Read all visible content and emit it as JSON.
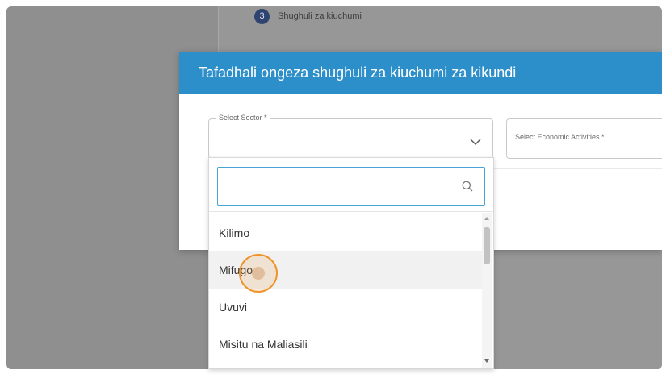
{
  "background": {
    "step_number": "3",
    "step_label": "Shughuli za kiuchumi"
  },
  "modal": {
    "title": "Tafadhali ongeza shughuli za kiuchumi za kikundi",
    "sector_label": "Select Sector *",
    "activities_placeholder": "Select Economic Activities *"
  },
  "dropdown": {
    "search_value": "",
    "options": [
      "Kilimo",
      "Mifugo",
      "Uvuvi",
      "Misitu na Maliasili"
    ],
    "hovered_option": "Mifugo"
  },
  "colors": {
    "modal_header": "#2d8fc9",
    "search_border": "#46a4d6",
    "cursor_highlight": "#f0932a"
  },
  "icons": [
    "chevron-down-icon",
    "search-icon",
    "scroll-up-arrow",
    "scroll-down-arrow"
  ]
}
